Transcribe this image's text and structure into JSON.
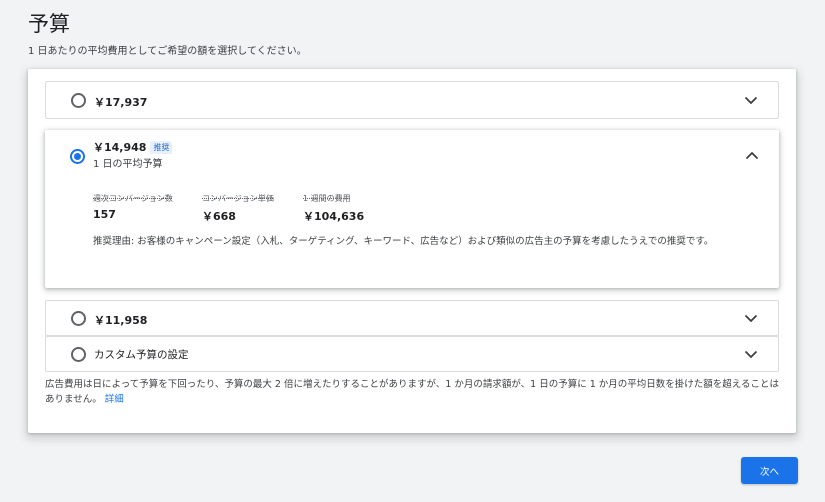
{
  "page": {
    "title": "予算",
    "subtitle": "1 日あたりの平均費用としてご希望の額を選択してください。"
  },
  "options": [
    {
      "amount": "￥17,937",
      "selected": false
    },
    {
      "amount": "￥14,948",
      "badge": "推奨",
      "sub_label": "1 日の平均予算",
      "selected": true,
      "metrics": [
        {
          "label": "週次コンバージョン数",
          "value": "157"
        },
        {
          "label": "コンバージョン単価",
          "value": "￥668"
        },
        {
          "label": "1 週間の費用",
          "value": "￥104,636"
        }
      ],
      "reason": "推奨理由: お客様のキャンペーン設定（入札、ターゲティング、キーワード、広告など）および類似の広告主の予算を考慮したうえでの推奨です。"
    },
    {
      "amount": "￥11,958",
      "selected": false
    },
    {
      "amount": "カスタム予算の設定",
      "selected": false
    }
  ],
  "note": {
    "text": "広告費用は日によって予算を下回ったり、予算の最大 2 倍に増えたりすることがありますが、1 か月の請求額が、1 日の予算に 1 か月の平均日数を掛けた額を超えることはありません。",
    "link": "詳細"
  },
  "actions": {
    "next_label": "次へ"
  },
  "colors": {
    "accent": "#1a73e8",
    "badge_bg": "#e8f0fe",
    "badge_text": "#1967d2"
  },
  "icons": {
    "collapsed": "chevron-down-icon",
    "expanded": "chevron-up-icon"
  }
}
